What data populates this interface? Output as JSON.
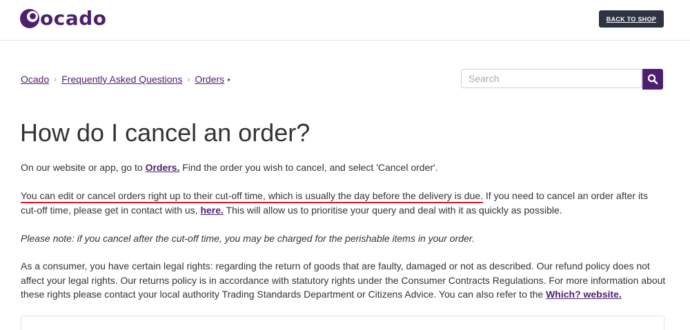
{
  "header": {
    "logo_text": "ocado",
    "back_button": "BACK TO SHOP"
  },
  "breadcrumb": {
    "items": [
      "Ocado",
      "Frequently Asked Questions",
      "Orders"
    ],
    "separator": "›"
  },
  "search": {
    "placeholder": "Search"
  },
  "main": {
    "title": "How do I cancel an order?",
    "p1": {
      "before": "On our website or app, go to ",
      "link": "Orders.",
      "after": " Find the order you wish to cancel, and select 'Cancel order'."
    },
    "p2": {
      "highlight": "You can edit or cancel orders right up to their cut-off time, which is usually the day before the delivery is due.",
      "after": " If you need to cancel an order after its cut-off time, please get in contact with us, ",
      "link": "here.",
      "tail": " This will allow us to prioritise your query and deal with it as quickly as possible."
    },
    "p3": "Please note: if you cancel after the cut-off time, you may be charged for the perishable items in your order.",
    "p4": {
      "text": "As a consumer, you have certain legal rights: regarding the return of goods that are faulty, damaged or not as described. Our refund policy does not affect your legal rights. Our returns policy is in accordance with statutory rights under the Consumer Contracts Regulations. For more information about these rights please contact your local authority Trading Standards Department or Citizens Advice. You can also refer to the ",
      "link": "Which? website."
    }
  },
  "colors": {
    "brand": "#4d1f6e",
    "button_dark": "#2e3440",
    "highlight_underline": "#d7192c"
  }
}
